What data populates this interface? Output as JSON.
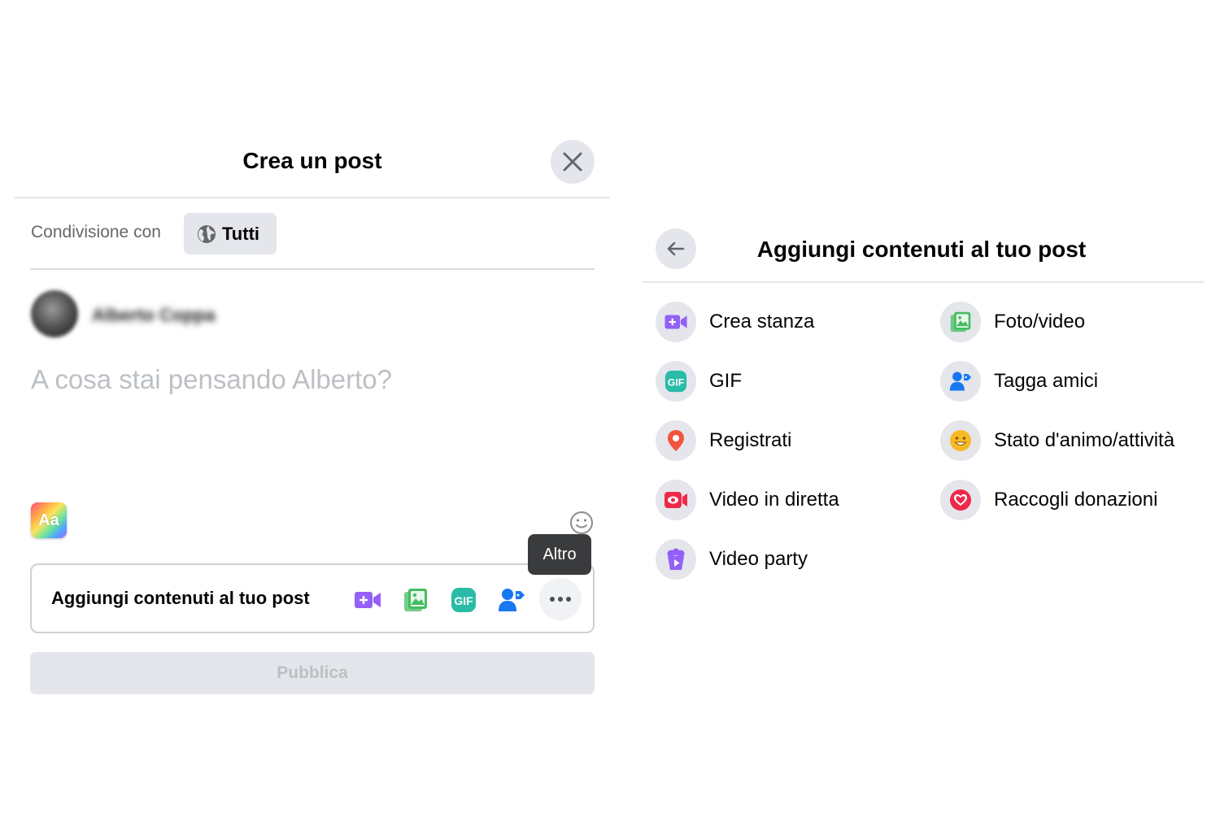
{
  "create_post": {
    "title": "Crea un post",
    "share_label": "Condivisione con",
    "audience": "Tutti",
    "username": "Alberto Coppa",
    "composer_placeholder": "A cosa stai pensando Alberto?",
    "aa_label": "Aa",
    "add_content_label": "Aggiungi contenuti al tuo post",
    "gif_label": "GIF",
    "tooltip": "Altro",
    "publish_label": "Pubblica"
  },
  "add_content": {
    "title": "Aggiungi contenuti al tuo post",
    "options": [
      {
        "label": "Crea stanza",
        "icon": "video-room-icon",
        "color": "#9360f7"
      },
      {
        "label": "Foto/video",
        "icon": "photo-icon",
        "color": "#45bd62"
      },
      {
        "label": "GIF",
        "icon": "gif-icon",
        "color": "#2abba7"
      },
      {
        "label": "Tagga amici",
        "icon": "tag-friends-icon",
        "color": "#1877f2"
      },
      {
        "label": "Registrati",
        "icon": "location-pin-icon",
        "color": "#f5533d"
      },
      {
        "label": "Stato d'animo/attività",
        "icon": "smiley-icon",
        "color": "#f7b928"
      },
      {
        "label": "Video in diretta",
        "icon": "live-video-icon",
        "color": "#f02849"
      },
      {
        "label": "Raccogli donazioni",
        "icon": "heart-icon",
        "color": "#f02849"
      },
      {
        "label": "Video party",
        "icon": "popcorn-icon",
        "color": "#9360f7"
      }
    ]
  }
}
